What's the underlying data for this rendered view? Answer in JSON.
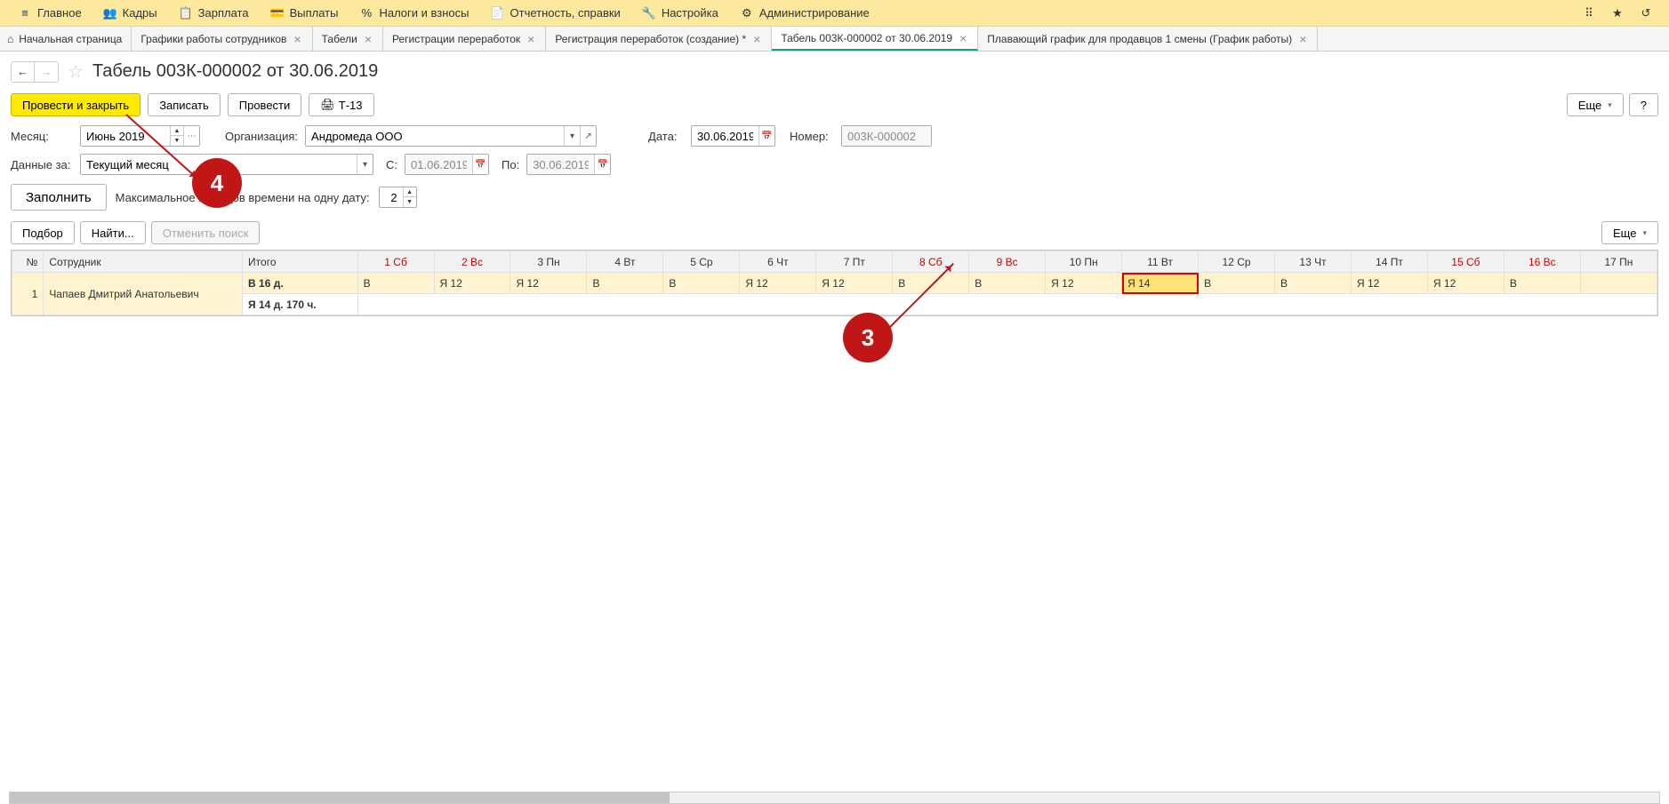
{
  "menu": {
    "items": [
      {
        "label": "Главное",
        "icon": "menu"
      },
      {
        "label": "Кадры",
        "icon": "people"
      },
      {
        "label": "Зарплата",
        "icon": "calc"
      },
      {
        "label": "Выплаты",
        "icon": "wallet"
      },
      {
        "label": "Налоги и взносы",
        "icon": "percent"
      },
      {
        "label": "Отчетность, справки",
        "icon": "doc"
      },
      {
        "label": "Настройка",
        "icon": "wrench"
      },
      {
        "label": "Администрирование",
        "icon": "gear"
      }
    ]
  },
  "tabs": [
    {
      "label": "Начальная страница",
      "home": true,
      "closable": false
    },
    {
      "label": "Графики работы сотрудников",
      "closable": true
    },
    {
      "label": "Табели",
      "closable": true
    },
    {
      "label": "Регистрации переработок",
      "closable": true
    },
    {
      "label": "Регистрация переработок (создание) *",
      "closable": true
    },
    {
      "label": "Табель 003К-000002 от 30.06.2019",
      "closable": true,
      "active": true
    },
    {
      "label": "Плавающий график для продавцов 1 смены (График работы)",
      "closable": true
    }
  ],
  "title": "Табель 003К-000002 от 30.06.2019",
  "toolbar": {
    "post_close": "Провести и закрыть",
    "save": "Записать",
    "post": "Провести",
    "t13": "Т-13",
    "more": "Еще",
    "help": "?"
  },
  "form": {
    "month_label": "Месяц:",
    "month_value": "Июнь 2019",
    "org_label": "Организация:",
    "org_value": "Андромеда ООО",
    "date_label": "Дата:",
    "date_value": "30.06.2019",
    "number_label": "Номер:",
    "number_value": "003К-000002",
    "datafor_label": "Данные за:",
    "datafor_value": "Текущий месяц",
    "from_label": "С:",
    "from_value": "01.06.2019",
    "to_label": "По:",
    "to_value": "30.06.2019",
    "fill_btn": "Заполнить",
    "max_types_label": "Максимальное ко               видов времени на одну дату:",
    "max_types_value": "2",
    "podbor": "Подбор",
    "find": "Найти...",
    "cancel_search": "Отменить поиск",
    "more2": "Еще"
  },
  "table": {
    "headers": {
      "num": "№",
      "emp": "Сотрудник",
      "total": "Итого",
      "days": [
        {
          "label": "1 Сб",
          "red": true
        },
        {
          "label": "2 Вс",
          "red": true
        },
        {
          "label": "3 Пн"
        },
        {
          "label": "4 Вт"
        },
        {
          "label": "5 Ср"
        },
        {
          "label": "6 Чт"
        },
        {
          "label": "7 Пт"
        },
        {
          "label": "8 Сб",
          "red": true
        },
        {
          "label": "9 Вс",
          "red": true
        },
        {
          "label": "10 Пн"
        },
        {
          "label": "11 Вт"
        },
        {
          "label": "12 Ср"
        },
        {
          "label": "13 Чт"
        },
        {
          "label": "14 Пт"
        },
        {
          "label": "15 Сб",
          "red": true
        },
        {
          "label": "16 Вс",
          "red": true
        },
        {
          "label": "17 Пн"
        }
      ]
    },
    "rows": [
      {
        "num": "1",
        "emp": "Чапаев Дмитрий Анатольевич",
        "total1": "В 16 д.",
        "total2": "Я 14 д. 170 ч.",
        "cells": [
          "В",
          "Я 12",
          "Я 12",
          "В",
          "В",
          "Я 12",
          "Я 12",
          "В",
          "В",
          "Я 12",
          "Я 14",
          "В",
          "В",
          "Я 12",
          "Я 12",
          "В"
        ],
        "highlight_idx": 10
      }
    ]
  },
  "callouts": {
    "c3": "3",
    "c4": "4"
  }
}
